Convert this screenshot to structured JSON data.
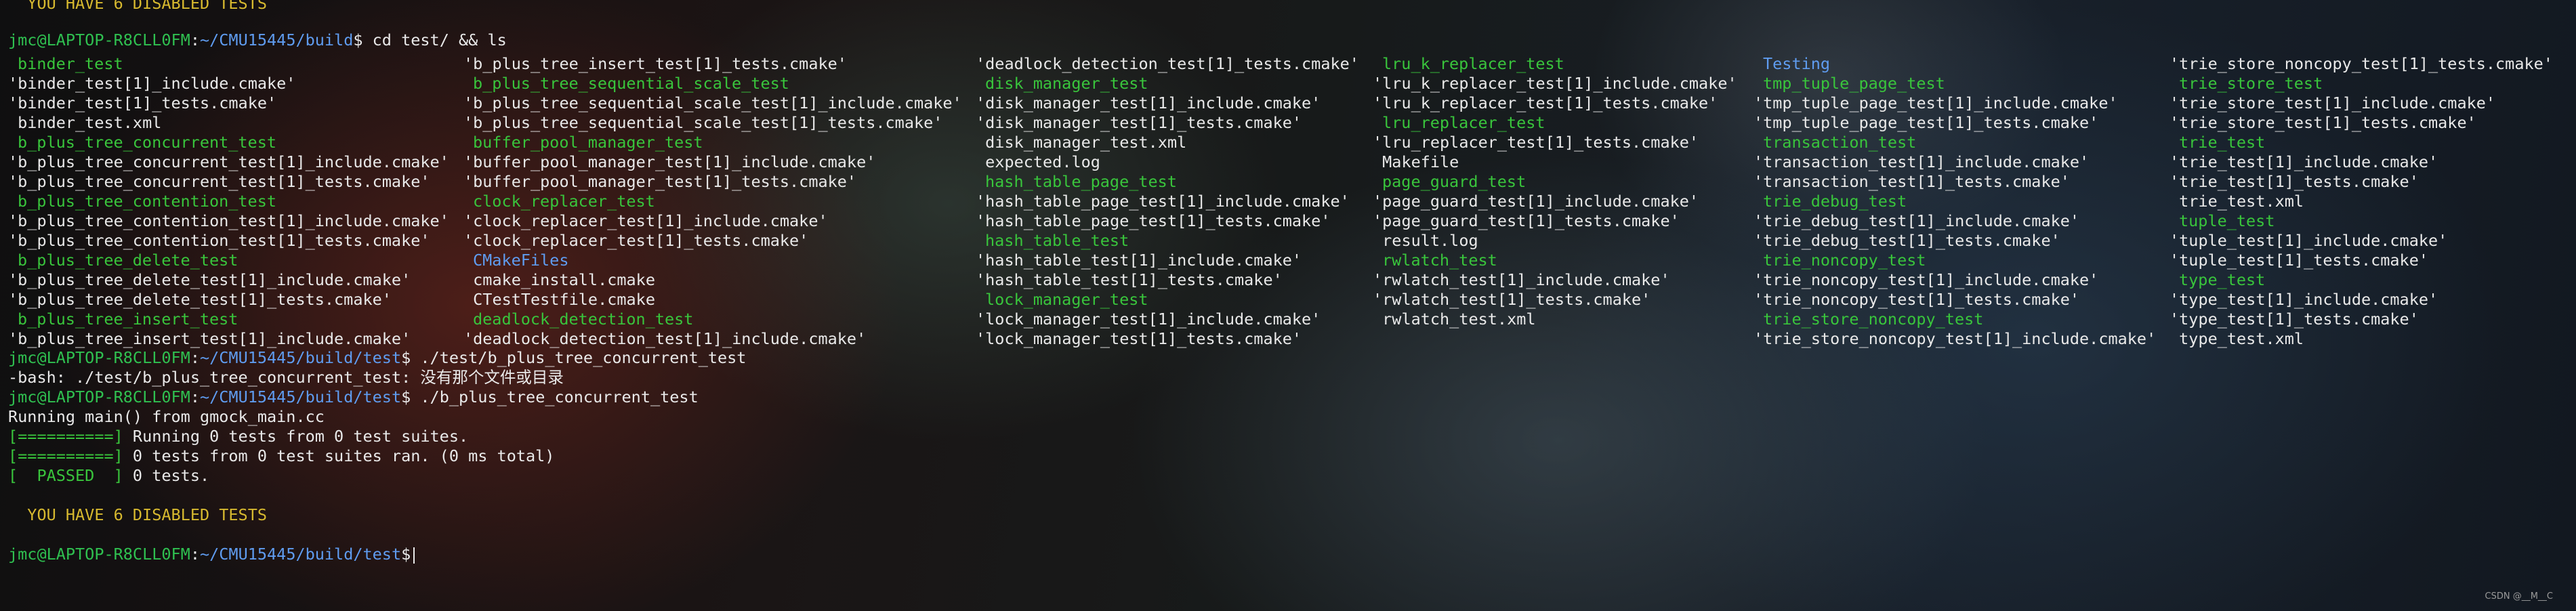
{
  "prompt": {
    "userhost": "jmc@LAPTOP-R8CLL0FM",
    "sep": ":",
    "path_build": "~/CMU15445/build",
    "path_test": "~/CMU15445/build/test",
    "symbol": "$"
  },
  "top_warning": "  YOU HAVE 6 DISABLED TESTS",
  "cmd1": " cd test/ && ls",
  "ls_columns": [
    [
      {
        "t": "binder_test",
        "c": "exe"
      },
      {
        "t": "'binder_test[1]_include.cmake'",
        "c": "w"
      },
      {
        "t": "'binder_test[1]_tests.cmake'",
        "c": "w"
      },
      {
        "t": " binder_test.xml",
        "c": "w"
      },
      {
        "t": "b_plus_tree_concurrent_test",
        "c": "exe"
      },
      {
        "t": "'b_plus_tree_concurrent_test[1]_include.cmake'",
        "c": "w"
      },
      {
        "t": "'b_plus_tree_concurrent_test[1]_tests.cmake'",
        "c": "w"
      },
      {
        "t": "b_plus_tree_contention_test",
        "c": "exe"
      },
      {
        "t": "'b_plus_tree_contention_test[1]_include.cmake'",
        "c": "w"
      },
      {
        "t": "'b_plus_tree_contention_test[1]_tests.cmake'",
        "c": "w"
      },
      {
        "t": "b_plus_tree_delete_test",
        "c": "exe"
      },
      {
        "t": "'b_plus_tree_delete_test[1]_include.cmake'",
        "c": "w"
      },
      {
        "t": "'b_plus_tree_delete_test[1]_tests.cmake'",
        "c": "w"
      },
      {
        "t": "b_plus_tree_insert_test",
        "c": "exe"
      },
      {
        "t": "'b_plus_tree_insert_test[1]_include.cmake'",
        "c": "w"
      }
    ],
    [
      {
        "t": "'b_plus_tree_insert_test[1]_tests.cmake'",
        "c": "w"
      },
      {
        "t": "b_plus_tree_sequential_scale_test",
        "c": "exe"
      },
      {
        "t": "'b_plus_tree_sequential_scale_test[1]_include.cmake'",
        "c": "w"
      },
      {
        "t": "'b_plus_tree_sequential_scale_test[1]_tests.cmake'",
        "c": "w"
      },
      {
        "t": "buffer_pool_manager_test",
        "c": "exe"
      },
      {
        "t": "'buffer_pool_manager_test[1]_include.cmake'",
        "c": "w"
      },
      {
        "t": "'buffer_pool_manager_test[1]_tests.cmake'",
        "c": "w"
      },
      {
        "t": "clock_replacer_test",
        "c": "exe"
      },
      {
        "t": "'clock_replacer_test[1]_include.cmake'",
        "c": "w"
      },
      {
        "t": "'clock_replacer_test[1]_tests.cmake'",
        "c": "w"
      },
      {
        "t": "CMakeFiles",
        "c": "dir"
      },
      {
        "t": " cmake_install.cmake",
        "c": "w"
      },
      {
        "t": " CTestTestfile.cmake",
        "c": "w"
      },
      {
        "t": "deadlock_detection_test",
        "c": "exe"
      },
      {
        "t": "'deadlock_detection_test[1]_include.cmake'",
        "c": "w"
      }
    ],
    [
      {
        "t": "'deadlock_detection_test[1]_tests.cmake'",
        "c": "w"
      },
      {
        "t": "disk_manager_test",
        "c": "exe"
      },
      {
        "t": "'disk_manager_test[1]_include.cmake'",
        "c": "w"
      },
      {
        "t": "'disk_manager_test[1]_tests.cmake'",
        "c": "w"
      },
      {
        "t": " disk_manager_test.xml",
        "c": "w"
      },
      {
        "t": " expected.log",
        "c": "w"
      },
      {
        "t": "hash_table_page_test",
        "c": "exe"
      },
      {
        "t": "'hash_table_page_test[1]_include.cmake'",
        "c": "w"
      },
      {
        "t": "'hash_table_page_test[1]_tests.cmake'",
        "c": "w"
      },
      {
        "t": "hash_table_test",
        "c": "exe"
      },
      {
        "t": "'hash_table_test[1]_include.cmake'",
        "c": "w"
      },
      {
        "t": "'hash_table_test[1]_tests.cmake'",
        "c": "w"
      },
      {
        "t": "lock_manager_test",
        "c": "exe"
      },
      {
        "t": "'lock_manager_test[1]_include.cmake'",
        "c": "w"
      },
      {
        "t": "'lock_manager_test[1]_tests.cmake'",
        "c": "w"
      }
    ],
    [
      {
        "t": "lru_k_replacer_test",
        "c": "exe"
      },
      {
        "t": "'lru_k_replacer_test[1]_include.cmake'",
        "c": "w"
      },
      {
        "t": "'lru_k_replacer_test[1]_tests.cmake'",
        "c": "w"
      },
      {
        "t": "lru_replacer_test",
        "c": "exe"
      },
      {
        "t": "'lru_replacer_test[1]_tests.cmake'",
        "c": "w"
      },
      {
        "t": " Makefile",
        "c": "w"
      },
      {
        "t": "page_guard_test",
        "c": "exe"
      },
      {
        "t": "'page_guard_test[1]_include.cmake'",
        "c": "w"
      },
      {
        "t": "'page_guard_test[1]_tests.cmake'",
        "c": "w"
      },
      {
        "t": " result.log",
        "c": "w"
      },
      {
        "t": "rwlatch_test",
        "c": "exe"
      },
      {
        "t": "'rwlatch_test[1]_include.cmake'",
        "c": "w"
      },
      {
        "t": "'rwlatch_test[1]_tests.cmake'",
        "c": "w"
      },
      {
        "t": " rwlatch_test.xml",
        "c": "w"
      },
      {
        "t": "",
        "c": "w"
      }
    ],
    [
      {
        "t": "Testing",
        "c": "dir"
      },
      {
        "t": "tmp_tuple_page_test",
        "c": "exe"
      },
      {
        "t": "'tmp_tuple_page_test[1]_include.cmake'",
        "c": "w"
      },
      {
        "t": "'tmp_tuple_page_test[1]_tests.cmake'",
        "c": "w"
      },
      {
        "t": "transaction_test",
        "c": "exe"
      },
      {
        "t": "'transaction_test[1]_include.cmake'",
        "c": "w"
      },
      {
        "t": "'transaction_test[1]_tests.cmake'",
        "c": "w"
      },
      {
        "t": "trie_debug_test",
        "c": "exe"
      },
      {
        "t": "'trie_debug_test[1]_include.cmake'",
        "c": "w"
      },
      {
        "t": "'trie_debug_test[1]_tests.cmake'",
        "c": "w"
      },
      {
        "t": "trie_noncopy_test",
        "c": "exe"
      },
      {
        "t": "'trie_noncopy_test[1]_include.cmake'",
        "c": "w"
      },
      {
        "t": "'trie_noncopy_test[1]_tests.cmake'",
        "c": "w"
      },
      {
        "t": "trie_store_noncopy_test",
        "c": "exe"
      },
      {
        "t": "'trie_store_noncopy_test[1]_include.cmake'",
        "c": "w"
      }
    ],
    [
      {
        "t": "'trie_store_noncopy_test[1]_tests.cmake'",
        "c": "w"
      },
      {
        "t": "trie_store_test",
        "c": "exe"
      },
      {
        "t": "'trie_store_test[1]_include.cmake'",
        "c": "w"
      },
      {
        "t": "'trie_store_test[1]_tests.cmake'",
        "c": "w"
      },
      {
        "t": "trie_test",
        "c": "exe"
      },
      {
        "t": "'trie_test[1]_include.cmake'",
        "c": "w"
      },
      {
        "t": "'trie_test[1]_tests.cmake'",
        "c": "w"
      },
      {
        "t": " trie_test.xml",
        "c": "w"
      },
      {
        "t": "tuple_test",
        "c": "exe"
      },
      {
        "t": "'tuple_test[1]_include.cmake'",
        "c": "w"
      },
      {
        "t": "'tuple_test[1]_tests.cmake'",
        "c": "w"
      },
      {
        "t": "type_test",
        "c": "exe"
      },
      {
        "t": "'type_test[1]_include.cmake'",
        "c": "w"
      },
      {
        "t": "'type_test[1]_tests.cmake'",
        "c": "w"
      },
      {
        "t": " type_test.xml",
        "c": "w"
      }
    ]
  ],
  "cmd2": " ./test/b_plus_tree_concurrent_test",
  "err2": "-bash: ./test/b_plus_tree_concurrent_test: 没有那个文件或目录",
  "cmd3": " ./b_plus_tree_concurrent_test",
  "out_running_main": "Running main() from gmock_main.cc",
  "gtest": {
    "tag_sep": "[==========]",
    "tag_passed": "[  PASSED  ]",
    "run_line": " Running 0 tests from 0 test suites.",
    "ran_line": " 0 tests from 0 test suites ran. (0 ms total)",
    "passed_line": " 0 tests."
  },
  "bottom_warning": "  YOU HAVE 6 DISABLED TESTS",
  "watermark": "CSDN @__M__C",
  "colors": {
    "text": "#e9e9e9",
    "dir": "#5f9cf0",
    "exe": "#39c53c",
    "warning": "#d7b92f",
    "prompt_user": "#2fc050"
  }
}
